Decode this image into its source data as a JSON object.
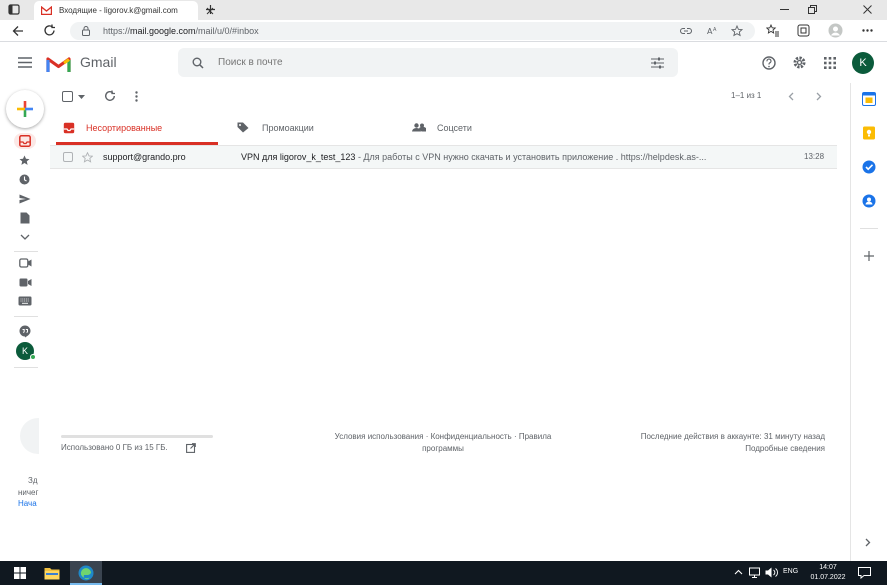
{
  "browser": {
    "tab_title": "Входящие - ligorov.k@gmail.com",
    "url_prefix": "https://",
    "url_host": "mail.google.com",
    "url_path": "/mail/u/0/#inbox"
  },
  "gmail": {
    "logo_text": "Gmail",
    "search_placeholder": "Поиск в почте",
    "avatar_letter": "K"
  },
  "toolbar": {
    "pager": "1–1 из 1"
  },
  "tabs": [
    {
      "label": "Несортированные"
    },
    {
      "label": "Промоакции"
    },
    {
      "label": "Соцсети"
    }
  ],
  "mails": [
    {
      "sender": "support@grando.pro",
      "subject": "VPN для ligorov_k_test_123",
      "snippet": " - Для работы с VPN нужно скачать и установить приложение . https://helpdesk.as-...",
      "time": "13:28"
    }
  ],
  "footer": {
    "usage": "Использовано 0 ГБ из 15 ГБ.",
    "links_line1": "Условия использования · Конфиденциальность · Правила",
    "links_line2": "программы",
    "activity_line1": "Последние действия в аккаунте: 31 минуту назад",
    "activity_line2": "Подробные сведения"
  },
  "hangouts_partial": {
    "line1": "Зд",
    "line2": "ничег",
    "line3": "Нача"
  },
  "taskbar": {
    "lang": "ENG",
    "time": "14:07",
    "date": "01.07.2022"
  },
  "colors": {
    "gmail_red": "#d93025",
    "avatar_green": "#0b5b3b",
    "link_blue": "#1a73e8"
  }
}
